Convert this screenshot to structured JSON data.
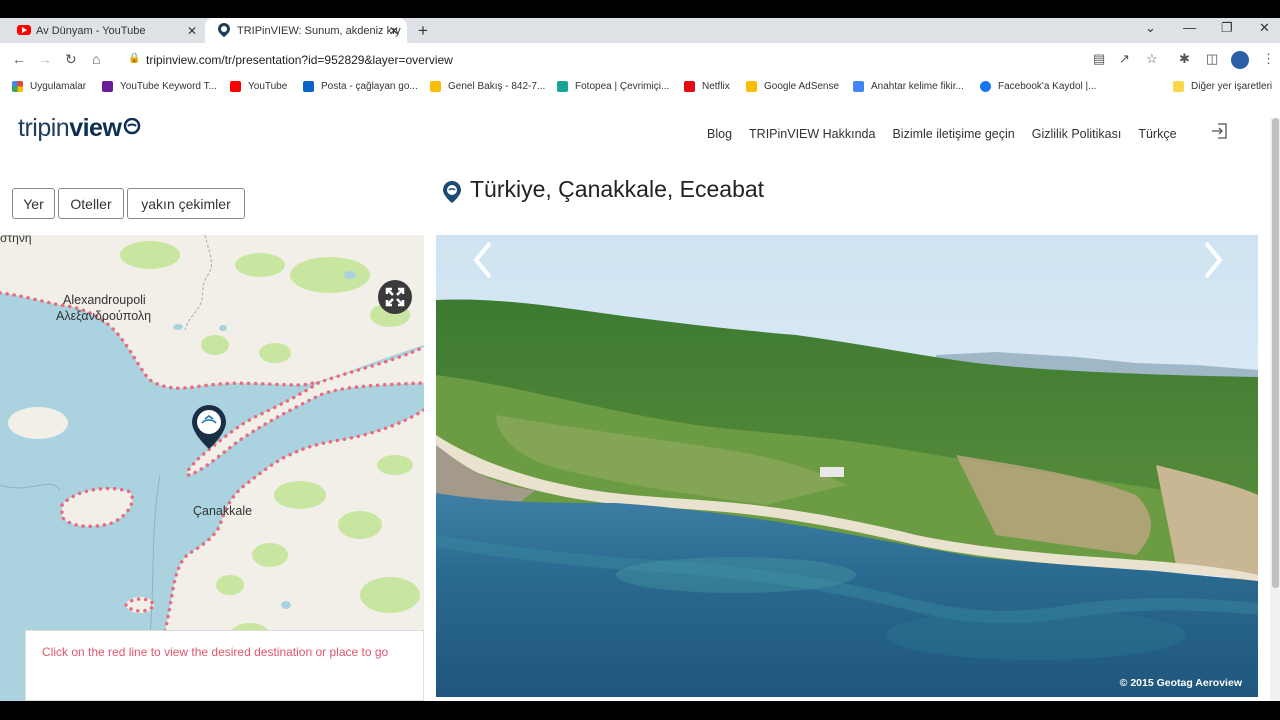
{
  "browser": {
    "tabs": [
      {
        "title": "Av Dünyam - YouTube",
        "close": "✕"
      },
      {
        "title": "TRIPinVIEW: Sunum, akdeniz kıy",
        "close": "✕"
      }
    ],
    "new_tab": "+",
    "window_controls": {
      "minimize": "—",
      "restore": "❐",
      "close": "✕",
      "tab_search": "⌄"
    },
    "url": "tripinview.com/tr/presentation?id=952829&layer=overview",
    "nav": {
      "back": "←",
      "forward": "→",
      "reload": "↻",
      "home": "⌂"
    },
    "bookmarks": [
      {
        "label": "Uygulamalar",
        "color": "#4285f4"
      },
      {
        "label": "YouTube Keyword T...",
        "color": "#6a1b9a"
      },
      {
        "label": "YouTube",
        "color": "#ff0000"
      },
      {
        "label": "Posta - çağlayan go...",
        "color": "#0a64c8"
      },
      {
        "label": "Genel Bakış - 842-7...",
        "color": "#fbbc04"
      },
      {
        "label": "Fotopea | Çevrimiçi...",
        "color": "#18a497"
      },
      {
        "label": "Netflix",
        "color": "#e50914"
      },
      {
        "label": "Google AdSense",
        "color": "#fbbc04"
      },
      {
        "label": "Anahtar kelime fikir...",
        "color": "#4285f4"
      },
      {
        "label": "Facebook'a Kaydol |...",
        "color": "#1877f2"
      },
      {
        "label": "Diğer yer işaretleri",
        "color": "#f9d949"
      }
    ]
  },
  "site": {
    "logo_prefix": "tripin",
    "logo_bold": "view",
    "nav": [
      "Blog",
      "TRIPinVIEW Hakkında",
      "Bizimle iletişime geçin",
      "Gizlilik Politikası",
      "Türkçe"
    ],
    "tabs": [
      "Yer",
      "Oteller",
      "yakın çekimler"
    ],
    "location_title": "Türkiye, Çanakkale, Eceabat"
  },
  "map": {
    "labels": {
      "top_left": "στηνη",
      "city1": "Alexandroupoli",
      "city1_greek": "Αλεξανδρούπολη",
      "city2": "Çanakkale"
    },
    "info_text": "Click on the red line to view the desired destination or place to go"
  },
  "photo": {
    "copyright": "© 2015 Geotag Aeroview",
    "prev": "‹",
    "next": "›"
  }
}
